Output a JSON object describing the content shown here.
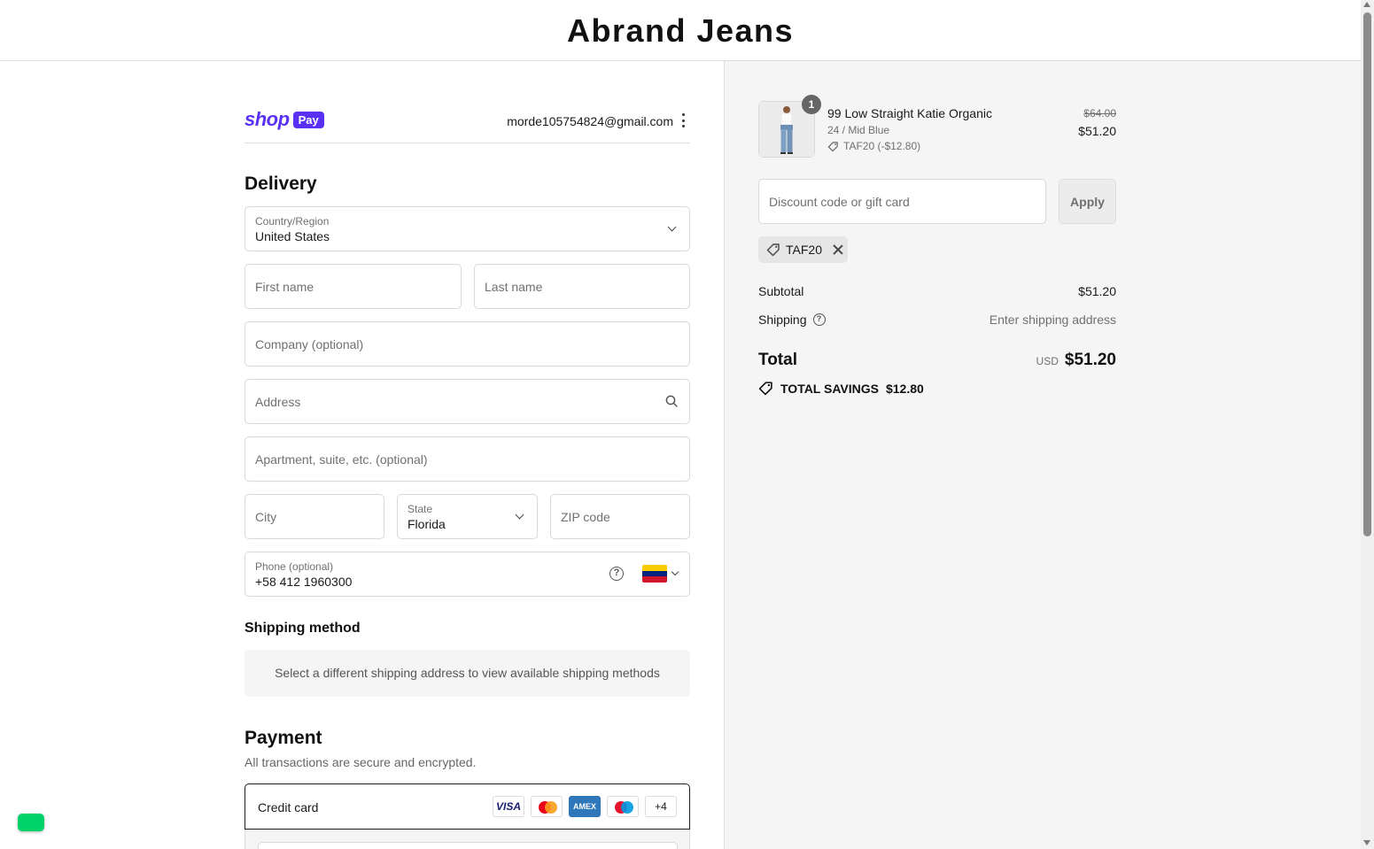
{
  "header": {
    "brand": "Abrand Jeans"
  },
  "account": {
    "shop_label": "shop",
    "pay_label": "Pay",
    "email": "morde105754824@gmail.com"
  },
  "delivery": {
    "title": "Delivery",
    "country": {
      "label": "Country/Region",
      "value": "United States"
    },
    "first_name": {
      "placeholder": "First name"
    },
    "last_name": {
      "placeholder": "Last name"
    },
    "company": {
      "placeholder": "Company (optional)"
    },
    "address": {
      "placeholder": "Address"
    },
    "apartment": {
      "placeholder": "Apartment, suite, etc. (optional)"
    },
    "city": {
      "placeholder": "City"
    },
    "state": {
      "label": "State",
      "value": "Florida"
    },
    "zip": {
      "placeholder": "ZIP code"
    },
    "phone": {
      "label": "Phone (optional)",
      "value": "+58 412 1960300",
      "help": "?"
    }
  },
  "shipping_method": {
    "title": "Shipping method",
    "message": "Select a different shipping address to view available shipping methods"
  },
  "payment": {
    "title": "Payment",
    "description": "All transactions are secure and encrypted.",
    "method_label": "Credit card",
    "cards": {
      "visa": "VISA",
      "amex": "AMEX",
      "more": "+4"
    }
  },
  "order": {
    "item": {
      "quantity": "1",
      "name": "99 Low Straight Katie Organic",
      "variant": "24 / Mid Blue",
      "discount": "TAF20 (-$12.80)",
      "original_price": "$64.00",
      "price": "$51.20"
    },
    "discount_field": {
      "placeholder": "Discount code or gift card"
    },
    "apply_label": "Apply",
    "applied_code": "TAF20",
    "subtotal": {
      "label": "Subtotal",
      "value": "$51.20"
    },
    "shipping": {
      "label": "Shipping",
      "value": "Enter shipping address",
      "help": "?"
    },
    "total": {
      "label": "Total",
      "currency": "USD",
      "value": "$51.20"
    },
    "savings": {
      "label": "TOTAL SAVINGS",
      "value": "$12.80"
    }
  },
  "colors": {
    "shop_pay": "#5a31f4",
    "summary_bg": "#f5f5f5",
    "chat_widget": "#00d26a"
  },
  "icons": [
    "chevron-down-icon",
    "search-icon",
    "help-icon",
    "venezuela-flag-icon",
    "tag-icon",
    "close-icon",
    "kebab-menu-icon",
    "chat-icon"
  ]
}
